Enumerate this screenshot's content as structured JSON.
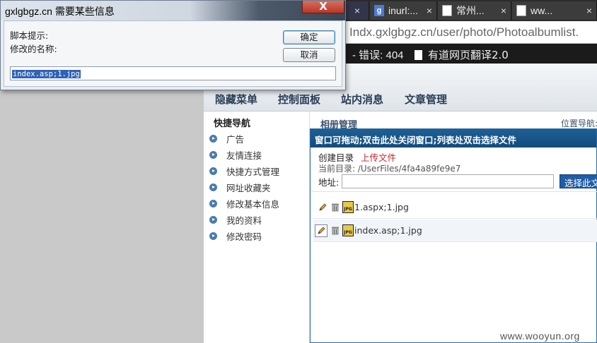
{
  "browser": {
    "tabs": [
      {
        "title": "",
        "ghost": true
      },
      {
        "title": "",
        "ghost": true
      },
      {
        "title": "inurl:...",
        "close": "×"
      },
      {
        "title": "常州...",
        "close": "×"
      },
      {
        "title": "ww...",
        "close": "×"
      }
    ],
    "url": "Indx.gxlgbgz.cn/user/photo/Photoalbumlist.",
    "error_text": "- 错误: 404",
    "bookmark": "有道网页翻译2.0"
  },
  "dialog": {
    "title": "gxlgbgz.cn 需要某些信息",
    "close": "X",
    "label_script": "脚本提示:",
    "label_prompt": "修改的名称:",
    "ok": "确定",
    "cancel": "取消",
    "input_value": "index.asp;1.jpg"
  },
  "page": {
    "nav": [
      "隐藏菜单",
      "控制面板",
      "站内消息",
      "文章管理"
    ],
    "sidebar_title": "快捷导航",
    "sidebar_items": [
      "广告",
      "友情连接",
      "快捷方式管理",
      "网址收藏夹",
      "修改基本信息",
      "我的资料",
      "修改密码"
    ],
    "main_title": "相册管理",
    "location": "位置导航:",
    "picker": {
      "header": "窗口可拖动;双击此处关闭窗口;列表处双击选择文件",
      "create_dir": "创建目录",
      "upload": "上传文件",
      "current_dir": "当前目录: /UserFiles/4fa4a89fe9e7",
      "address_label": "地址:",
      "select_button": "选择此文件",
      "files": [
        {
          "name": "1.aspx;1.jpg",
          "icon_text": "JPG"
        },
        {
          "name": "index.asp;1.jpg",
          "icon_text": "JPG"
        }
      ]
    }
  },
  "watermark": "www.wooyun.org"
}
